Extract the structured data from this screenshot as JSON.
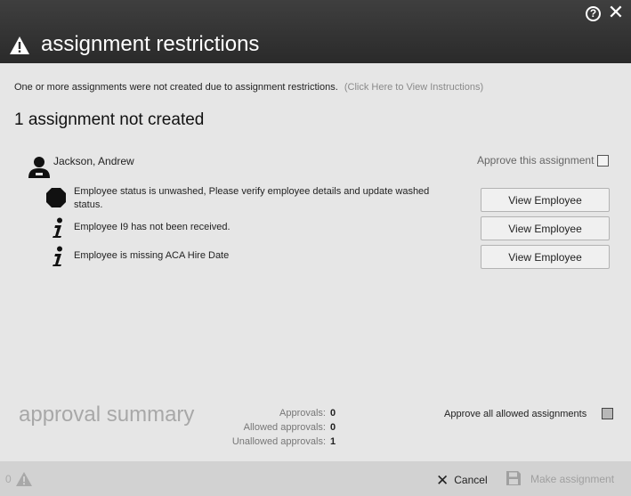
{
  "dialog": {
    "title": "assignment restrictions",
    "help_glyph": "?",
    "close_glyph": "✕"
  },
  "notice": {
    "text": "One or more assignments were not created due to assignment restrictions.",
    "link": "(Click Here to View Instructions)"
  },
  "heading": "1 assignment not created",
  "assignment": {
    "employee_name": "Jackson, Andrew",
    "approve_label": "Approve this assignment",
    "approve_checked": false,
    "issues": [
      {
        "icon": "stop-icon",
        "text": "Employee status is unwashed, Please verify employee details and update washed status.",
        "button": "View Employee"
      },
      {
        "icon": "info-icon",
        "text": "Employee I9 has not been received.",
        "button": "View Employee"
      },
      {
        "icon": "info-icon",
        "text": "Employee is missing ACA Hire Date",
        "button": "View Employee"
      }
    ]
  },
  "summary": {
    "title": "approval summary",
    "approvals_label": "Approvals:",
    "approvals_value": "0",
    "allowed_label": "Allowed approvals:",
    "allowed_value": "0",
    "unallowed_label": "Unallowed approvals:",
    "unallowed_value": "1",
    "approve_all_label": "Approve all allowed assignments",
    "approve_all_checked": false
  },
  "footer": {
    "warning_count": "0",
    "cancel_label": "Cancel",
    "make_label": "Make assignment"
  },
  "colors": {
    "titlebar": "#333333",
    "background": "#e6e6e6",
    "footer": "#d2d2d2",
    "muted_text": "#a8a8a8"
  }
}
